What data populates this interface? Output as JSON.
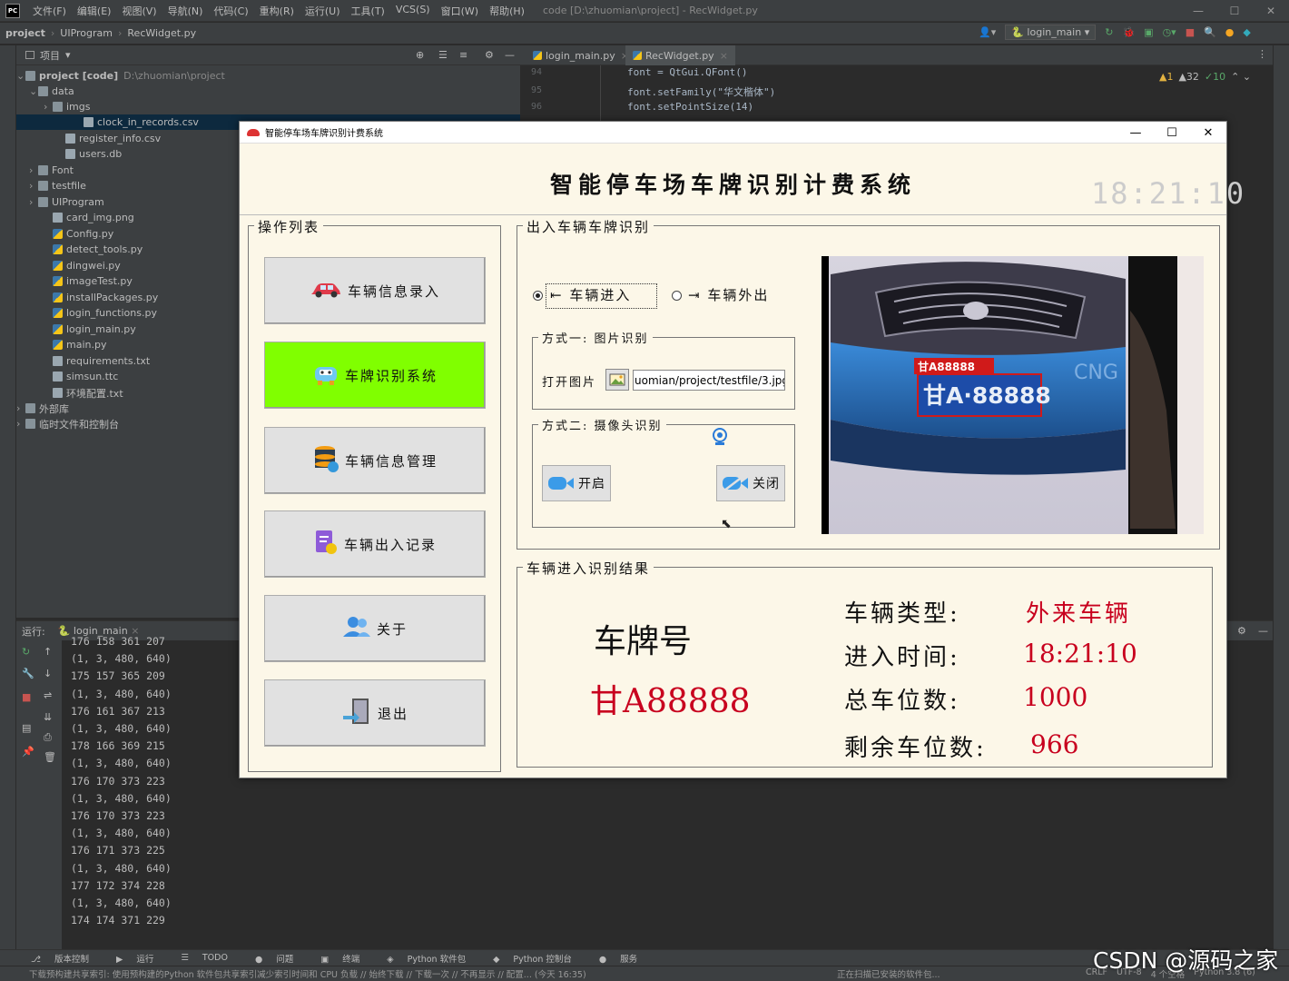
{
  "ide": {
    "menu": [
      "文件(F)",
      "编辑(E)",
      "视图(V)",
      "导航(N)",
      "代码(C)",
      "重构(R)",
      "运行(U)",
      "工具(T)",
      "VCS(S)",
      "窗口(W)",
      "帮助(H)"
    ],
    "window_title": "code [D:\\zhuomian\\project] - RecWidget.py",
    "breadcrumb": [
      "project",
      "UIProgram",
      "RecWidget.py"
    ],
    "run_config": "login_main",
    "project_header": "项目",
    "tree": [
      {
        "label": "project [code]",
        "extra": "D:\\zhuomian\\project",
        "type": "folder",
        "level": 0
      },
      {
        "label": "data",
        "type": "folder",
        "level": 1
      },
      {
        "label": "imgs",
        "type": "folder",
        "level": 2
      },
      {
        "label": "clock_in_records.csv",
        "type": "file",
        "level": 3,
        "selected": true
      },
      {
        "label": "register_info.csv",
        "type": "file",
        "level": 3
      },
      {
        "label": "users.db",
        "type": "file",
        "level": 3
      },
      {
        "label": "Font",
        "type": "folder",
        "level": 1
      },
      {
        "label": "testfile",
        "type": "folder",
        "level": 1
      },
      {
        "label": "UIProgram",
        "type": "folder",
        "level": 1
      },
      {
        "label": "card_img.png",
        "type": "file",
        "level": 2
      },
      {
        "label": "Config.py",
        "type": "py",
        "level": 2
      },
      {
        "label": "detect_tools.py",
        "type": "py",
        "level": 2
      },
      {
        "label": "dingwei.py",
        "type": "py",
        "level": 2
      },
      {
        "label": "imageTest.py",
        "type": "py",
        "level": 2
      },
      {
        "label": "installPackages.py",
        "type": "py",
        "level": 2
      },
      {
        "label": "login_functions.py",
        "type": "py",
        "level": 2
      },
      {
        "label": "login_main.py",
        "type": "py",
        "level": 2
      },
      {
        "label": "main.py",
        "type": "py",
        "level": 2
      },
      {
        "label": "requirements.txt",
        "type": "file",
        "level": 2
      },
      {
        "label": "simsun.ttc",
        "type": "file",
        "level": 2
      },
      {
        "label": "环境配置.txt",
        "type": "file",
        "level": 2
      },
      {
        "label": "外部库",
        "type": "folder",
        "level": 0
      },
      {
        "label": "临时文件和控制台",
        "type": "folder",
        "level": 0
      }
    ],
    "editor_tabs": [
      "login_main.py",
      "RecWidget.py"
    ],
    "code_lines": [
      {
        "n": "94",
        "text": "font = QtGui.QFont()"
      },
      {
        "n": "95",
        "text": "font.setFamily(\"华文楷体\")"
      },
      {
        "n": "96",
        "text": "font.setPointSize(14)"
      }
    ],
    "inspections": {
      "warn": "▲1",
      "weak": "▲32",
      "ok": "✓10"
    },
    "run_label": "运行:",
    "run_tab": "login_main",
    "console": [
      "176 158 361 207",
      "(1, 3, 480, 640)",
      "175 157 365 209",
      "(1, 3, 480, 640)",
      "176 161 367 213",
      "(1, 3, 480, 640)",
      "178 166 369 215",
      "(1, 3, 480, 640)",
      "176 170 373 223",
      "(1, 3, 480, 640)",
      "176 170 373 223",
      "(1, 3, 480, 640)",
      "176 171 373 225",
      "(1, 3, 480, 640)",
      "177 172 374 228",
      "(1, 3, 480, 640)",
      "174 174 371 229"
    ],
    "status_tools": [
      "版本控制",
      "运行",
      "TODO",
      "问题",
      "终端",
      "Python 软件包",
      "Python 控制台",
      "服务"
    ],
    "bottom_msg": "下载预构建共享索引: 使用预构建的Python 软件包共享索引减少索引时间和 CPU 负载 // 始终下载 // 下载一次 // 不再显示 // 配置... (今天 16:35)",
    "bottom_right": "正在扫描已安装的软件包...",
    "bottom_info": [
      "CRLF",
      "UTF-8",
      "4 个空格",
      "Python 3.8 (6)"
    ],
    "watermark": "CSDN @源码之家"
  },
  "app": {
    "window_title": "智能停车场车牌识别计费系统",
    "heading": "智能停车场车牌识别计费系统",
    "clock": "18:21:10",
    "ops_title": "操作列表",
    "ops": [
      {
        "label": "车辆信息录入",
        "icon": "car-icon"
      },
      {
        "label": "车牌识别系统",
        "icon": "robot-car-icon",
        "active": true
      },
      {
        "label": "车辆信息管理",
        "icon": "database-icon"
      },
      {
        "label": "车辆出入记录",
        "icon": "record-icon"
      },
      {
        "label": "关于",
        "icon": "users-icon"
      },
      {
        "label": "退出",
        "icon": "exit-icon"
      }
    ],
    "rec_title": "出入车辆车牌识别",
    "mode_in": "车辆进入",
    "mode_out": "车辆外出",
    "method1_title": "方式一: 图片识别",
    "open_img_label": "打开图片",
    "img_path": "uomian/project/testfile/3.jpg",
    "method2_title": "方式二: 摄像头识别",
    "cam_open": "开启",
    "cam_close": "关闭",
    "plate_overlay": "甘A88888",
    "plate_on_car": "甘A·88888",
    "car_text": "CNG",
    "result_title": "车辆进入识别结果",
    "plate_label": "车牌号",
    "plate_value": "甘A88888",
    "type_label": "车辆类型:",
    "type_value": "外来车辆",
    "time_label": "进入时间:",
    "time_value": "18:21:10",
    "total_label": "总车位数:",
    "total_value": "1000",
    "remain_label": "剩余车位数:",
    "remain_value": "966",
    "colors": {
      "active_btn": "#80ff00",
      "red": "#c8001e",
      "bg": "#fcf7e8"
    }
  }
}
